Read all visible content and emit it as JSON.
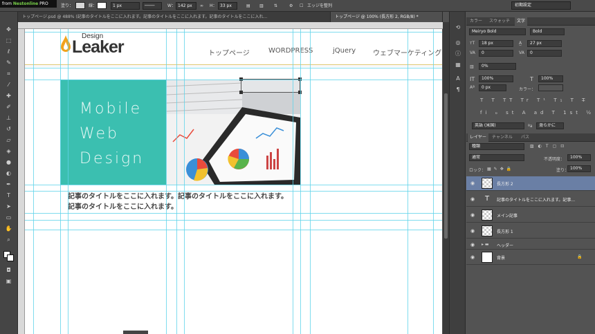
{
  "branding": {
    "from": "from ",
    "brand": "Nestonline",
    "pro": " PRO"
  },
  "options_bar": {
    "fill_label": "塗り：",
    "stroke_label": "線：",
    "stroke_width": "1 px",
    "w_label": "W：",
    "w_value": "142 px",
    "h_label": "H：",
    "h_value": "33 px",
    "align_edges": "エッジを整列",
    "workspace": "初期設定"
  },
  "tabs": [
    "トップページ.psd @ 488% (記事のタイトルをここに入れます。記事のタイトルをここに入れます。記事のタイトルをここに入れ...",
    "トップページ @ 100% (長方形 2, RGB/8) *"
  ],
  "canvas": {
    "logo_top": "Design",
    "logo_main": "Leaker",
    "nav": [
      "トップページ",
      "WORDPRESS",
      "jQuery",
      "ウェブマーケティング"
    ],
    "hero_lines": [
      "Mobile",
      "Web",
      "Design"
    ],
    "article_title": "記事のタイトルをここに入れます。記事のタイトルをここに入れます。記事のタイトルをここに入れます。",
    "accent_color": "#3bbfb0"
  },
  "character_panel": {
    "tabs": [
      "カラー",
      "スウォッチ",
      "文字"
    ],
    "font_family": "Meiryo Bold",
    "font_style": "Bold",
    "font_size": "18 px",
    "leading": "27 px",
    "kerning": "0",
    "tracking": "0",
    "tsume": "0%",
    "vscale": "100%",
    "hscale": "100%",
    "baseline": "0 px",
    "color_label": "カラー：",
    "language": "英語 (米国)",
    "antialias": "滑らかに",
    "aa_label": "ªa"
  },
  "layers_panel": {
    "tabs": [
      "レイヤー",
      "チャンネル",
      "パス"
    ],
    "filter": "種類",
    "blend_mode": "通常",
    "opacity_label": "不透明度：",
    "opacity": "100%",
    "lock_label": "ロック：",
    "fill_label": "塗り：",
    "fill": "100%",
    "layers": [
      "長方形 2",
      "記事のタイトルをここに入れます。記事...",
      "メイン記事",
      "長方形 1",
      "ヘッダー",
      "背景"
    ]
  }
}
